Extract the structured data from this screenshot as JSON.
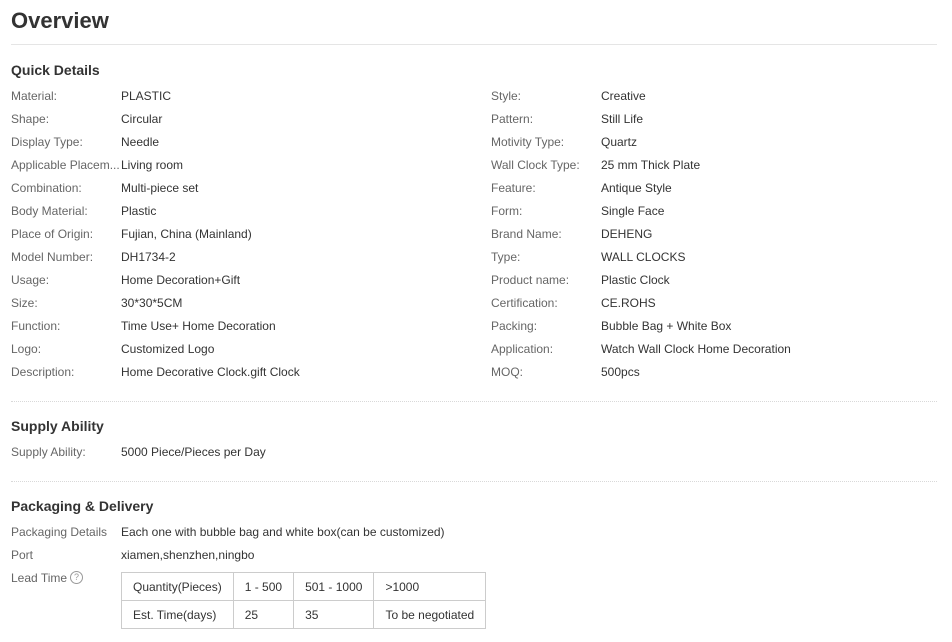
{
  "page": {
    "title": "Overview"
  },
  "quick_details": {
    "title": "Quick Details",
    "left": [
      {
        "label": "Material:",
        "value": "PLASTIC"
      },
      {
        "label": "Shape:",
        "value": "Circular"
      },
      {
        "label": "Display Type:",
        "value": "Needle"
      },
      {
        "label": "Applicable Placem...",
        "value": "Living room"
      },
      {
        "label": "Combination:",
        "value": "Multi-piece set"
      },
      {
        "label": "Body Material:",
        "value": "Plastic"
      },
      {
        "label": "Place of Origin:",
        "value": "Fujian, China (Mainland)"
      },
      {
        "label": "Model Number:",
        "value": "DH1734-2"
      },
      {
        "label": "Usage:",
        "value": "Home Decoration+Gift"
      },
      {
        "label": "Size:",
        "value": "30*30*5CM"
      },
      {
        "label": "Function:",
        "value": "Time Use+ Home Decoration"
      },
      {
        "label": "Logo:",
        "value": "Customized Logo"
      },
      {
        "label": "Description:",
        "value": "Home Decorative Clock.gift Clock"
      }
    ],
    "right": [
      {
        "label": "Style:",
        "value": "Creative"
      },
      {
        "label": "Pattern:",
        "value": "Still Life"
      },
      {
        "label": "Motivity Type:",
        "value": "Quartz"
      },
      {
        "label": "Wall Clock Type:",
        "value": "25 mm Thick Plate"
      },
      {
        "label": "Feature:",
        "value": "Antique Style"
      },
      {
        "label": "Form:",
        "value": "Single Face"
      },
      {
        "label": "Brand Name:",
        "value": "DEHENG"
      },
      {
        "label": "Type:",
        "value": "WALL CLOCKS"
      },
      {
        "label": "Product name:",
        "value": "Plastic Clock"
      },
      {
        "label": "Certification:",
        "value": "CE.ROHS"
      },
      {
        "label": "Packing:",
        "value": "Bubble Bag + White Box"
      },
      {
        "label": "Application:",
        "value": "Watch Wall Clock Home Decoration"
      },
      {
        "label": "MOQ:",
        "value": "500pcs"
      }
    ]
  },
  "supply_ability": {
    "title": "Supply Ability",
    "label": "Supply Ability:",
    "value": "5000 Piece/Pieces per Day"
  },
  "packaging_delivery": {
    "title": "Packaging & Delivery",
    "details_label": "Packaging Details",
    "details_value": "Each one with bubble bag and white box(can be customized)",
    "port_label": "Port",
    "port_value": "xiamen,shenzhen,ningbo",
    "lead_time_label": "Lead Time",
    "help_icon_glyph": "?",
    "lead_time_table": [
      [
        "Quantity(Pieces)",
        "1 - 500",
        "501 - 1000",
        ">1000"
      ],
      [
        "Est. Time(days)",
        "25",
        "35",
        "To be negotiated"
      ]
    ]
  },
  "icons": {
    "help": "question-circle-icon"
  },
  "colors": {
    "label": "#666666",
    "value": "#333333",
    "border": "#cccccc"
  }
}
